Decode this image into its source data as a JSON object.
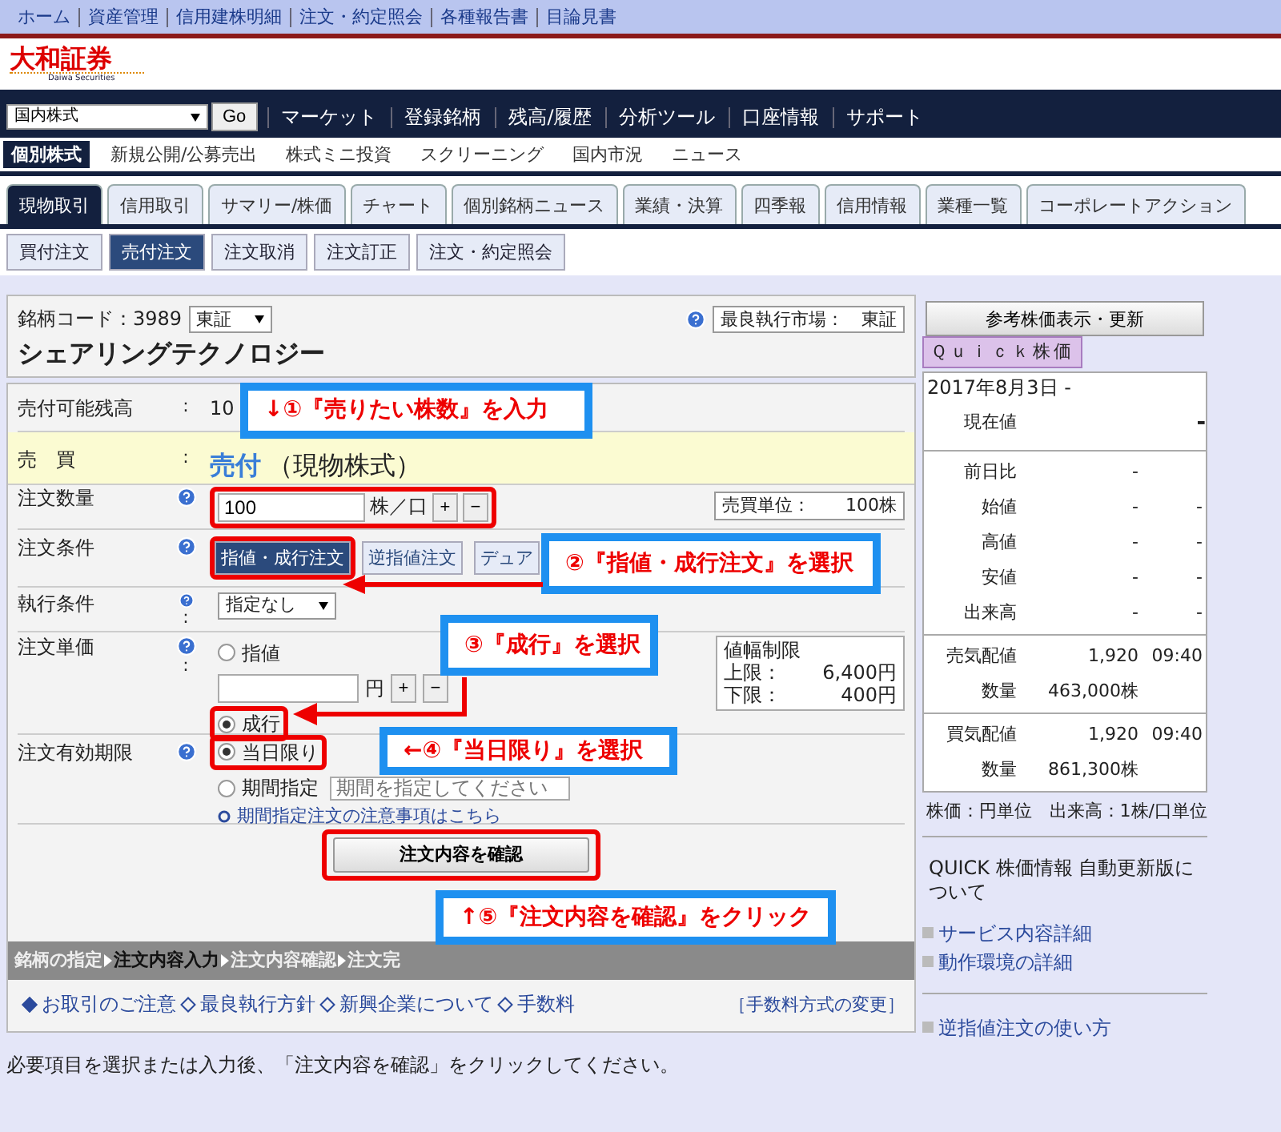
{
  "top_links": [
    "ホーム",
    "資産管理",
    "信用建株明細",
    "注文・約定照会",
    "各種報告書",
    "目論見書"
  ],
  "logo": {
    "name": "大和証券",
    "subtitle": "Daiwa Securities"
  },
  "market_select": {
    "value": "国内株式",
    "button": "Go"
  },
  "main_nav": [
    "マーケット",
    "登録銘柄",
    "残高/履歴",
    "分析ツール",
    "口座情報",
    "サポート"
  ],
  "sub_nav": [
    {
      "label": "個別株式",
      "selected": true
    },
    {
      "label": "新規公開/公募売出",
      "selected": false
    },
    {
      "label": "株式ミニ投資",
      "selected": false
    },
    {
      "label": "スクリーニング",
      "selected": false
    },
    {
      "label": "国内市況",
      "selected": false
    },
    {
      "label": "ニュース",
      "selected": false
    }
  ],
  "tabs": [
    {
      "label": "現物取引",
      "selected": true
    },
    {
      "label": "信用取引",
      "selected": false
    },
    {
      "label": "サマリー/株価",
      "selected": false
    },
    {
      "label": "チャート",
      "selected": false
    },
    {
      "label": "個別銘柄ニュース",
      "selected": false
    },
    {
      "label": "業績・決算",
      "selected": false
    },
    {
      "label": "四季報",
      "selected": false
    },
    {
      "label": "信用情報",
      "selected": false
    },
    {
      "label": "業種一覧",
      "selected": false
    },
    {
      "label": "コーポレートアクション",
      "selected": false
    }
  ],
  "sub_tabs": [
    {
      "label": "買付注文",
      "selected": false
    },
    {
      "label": "売付注文",
      "selected": true
    },
    {
      "label": "注文取消",
      "selected": false
    },
    {
      "label": "注文訂正",
      "selected": false
    },
    {
      "label": "注文・約定照会",
      "selected": false
    }
  ],
  "stock": {
    "code_label": "銘柄コード：3989",
    "exchange": "東証",
    "best_market": "最良執行市場：　東証",
    "name": "シェアリングテクノロジー"
  },
  "form": {
    "balance": {
      "label": "売付可能残高",
      "colon": ":",
      "value": "10"
    },
    "trade": {
      "label": "売　買",
      "colon": ":",
      "value": "売付",
      "suffix": "（現物株式）"
    },
    "quantity": {
      "label": "注文数量",
      "value": "100",
      "unit": "株／口",
      "plus": "+",
      "minus": "−",
      "trade_unit": "売買単位：　　100株",
      "highlighted": true
    },
    "conditions": {
      "label": "注文条件",
      "options": [
        {
          "label": "指値・成行注文",
          "selected": true,
          "highlighted": true
        },
        {
          "label": "逆指値注文",
          "selected": false,
          "highlighted": false
        },
        {
          "label": "デュア",
          "selected": false,
          "highlighted": false
        }
      ]
    },
    "execution": {
      "label": "執行条件",
      "colon": ":",
      "value": "指定なし"
    },
    "price": {
      "label": "注文単価",
      "colon": ":",
      "options": [
        {
          "label": "指値",
          "selected": false,
          "highlighted": false
        },
        {
          "label": "成行",
          "selected": true,
          "highlighted": true
        }
      ],
      "unit": "円",
      "plus": "+",
      "minus": "−",
      "limits": {
        "title": "値幅制限",
        "rows": [
          {
            "label": "上限：",
            "value": "6,400円"
          },
          {
            "label": "下限：",
            "value": "400円"
          }
        ]
      }
    },
    "expiry": {
      "label": "注文有効期限",
      "options": [
        {
          "label": "当日限り",
          "selected": true,
          "highlighted": true
        },
        {
          "label": "期間指定",
          "selected": false,
          "highlighted": false
        }
      ],
      "period_placeholder": "期間を指定してください",
      "note": "期間指定注文の注意事項はこちら"
    },
    "confirm": {
      "label": "注文内容を確認",
      "highlighted": true
    }
  },
  "steps": [
    {
      "label": "銘柄の指定",
      "current": false
    },
    {
      "label": "注文内容入力",
      "current": true
    },
    {
      "label": "注文内容確認",
      "current": false
    },
    {
      "label": "注文完",
      "current": false
    }
  ],
  "footer_links": [
    {
      "label": "お取引のご注意",
      "filled": true
    },
    {
      "label": "最良執行方針",
      "filled": false
    },
    {
      "label": "新興企業について",
      "filled": false
    },
    {
      "label": "手数料",
      "filled": false
    }
  ],
  "fee_link": "［手数料方式の変更］",
  "instruction": "必要項目を選択または入力後、「注文内容を確認」をクリックしてください。",
  "side": {
    "refresh_button": "参考株価表示・更新",
    "quick_tab": "Ｑｕｉｃｋ株価",
    "date": "2017年8月3日 -",
    "current": {
      "label": "現在値",
      "value": "-"
    },
    "rows": [
      {
        "label": "前日比",
        "value": "-",
        "time": ""
      },
      {
        "label": "始値",
        "value": "-",
        "time": "-"
      },
      {
        "label": "高値",
        "value": "-",
        "time": "-"
      },
      {
        "label": "安値",
        "value": "-",
        "time": "-"
      },
      {
        "label": "出来高",
        "value": "-",
        "time": "-"
      }
    ],
    "quotes": [
      {
        "label": "売気配値",
        "value": "1,920",
        "time": "09:40",
        "qty_label": "数量",
        "qty": "463,000株"
      },
      {
        "label": "買気配値",
        "value": "1,920",
        "time": "09:40",
        "qty_label": "数量",
        "qty": "861,300株"
      }
    ],
    "unit_note": "株価：円単位　出来高：1株/口単位",
    "quick_info": "QUICK 株価情報 自動更新版について",
    "links": [
      "サービス内容詳細",
      "動作環境の詳細"
    ],
    "bottom_link": "逆指値注文の使い方"
  },
  "callouts": [
    {
      "text": "↓①『売りたい株数』を入力",
      "kind": "plain"
    },
    {
      "text": "②『指値・成行注文』を選択",
      "kind": "arrow-left"
    },
    {
      "text": "③『成行』を選択",
      "kind": "arrow-diagonal"
    },
    {
      "text": "←④『当日限り』を選択",
      "kind": "plain"
    },
    {
      "text": "↑⑤『注文内容を確認』をクリック",
      "kind": "plain"
    }
  ]
}
